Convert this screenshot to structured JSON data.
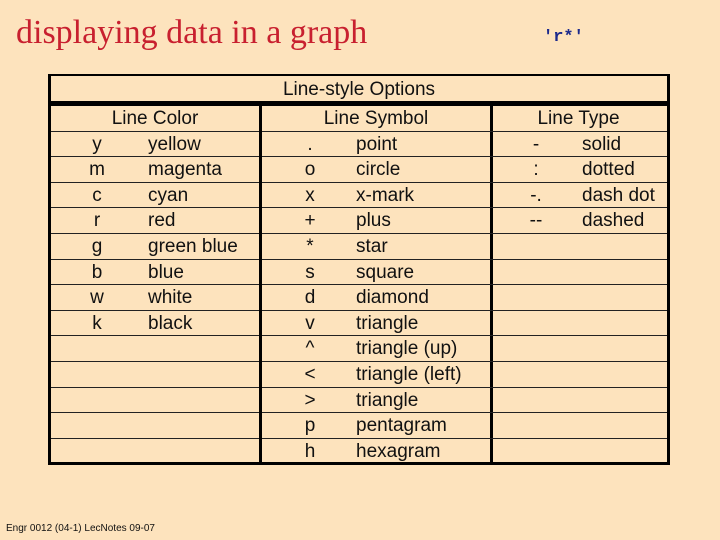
{
  "slide": {
    "title": "displaying data in a graph",
    "code_example": "'r*'",
    "footer": "Engr 0012 (04-1) LecNotes 09-07"
  },
  "table": {
    "title": "Line-style Options",
    "columns": [
      {
        "header": "Line Color",
        "rows": [
          {
            "key": "y",
            "value": "yellow"
          },
          {
            "key": "m",
            "value": "magenta"
          },
          {
            "key": "c",
            "value": "cyan"
          },
          {
            "key": "r",
            "value": "red"
          },
          {
            "key": "g",
            "value": "green blue"
          },
          {
            "key": "b",
            "value": "blue"
          },
          {
            "key": "w",
            "value": "white"
          },
          {
            "key": "k",
            "value": "black"
          }
        ]
      },
      {
        "header": "Line Symbol",
        "rows": [
          {
            "key": ".",
            "value": "point"
          },
          {
            "key": "o",
            "value": "circle"
          },
          {
            "key": "x",
            "value": "x-mark"
          },
          {
            "key": "+",
            "value": "plus"
          },
          {
            "key": "*",
            "value": "star"
          },
          {
            "key": "s",
            "value": "square"
          },
          {
            "key": "d",
            "value": "diamond"
          },
          {
            "key": "v",
            "value": "triangle"
          },
          {
            "key": "^",
            "value": "triangle (up)"
          },
          {
            "key": "<",
            "value": "triangle (left)"
          },
          {
            "key": ">",
            "value": "triangle"
          },
          {
            "key": "p",
            "value": "pentagram"
          },
          {
            "key": "h",
            "value": "hexagram"
          }
        ]
      },
      {
        "header": "Line Type",
        "rows": [
          {
            "key": "-",
            "value": "solid"
          },
          {
            "key": ":",
            "value": "dotted"
          },
          {
            "key": "-.",
            "value": "dash dot"
          },
          {
            "key": "--",
            "value": "dashed"
          }
        ]
      }
    ],
    "total_rows": 13
  }
}
